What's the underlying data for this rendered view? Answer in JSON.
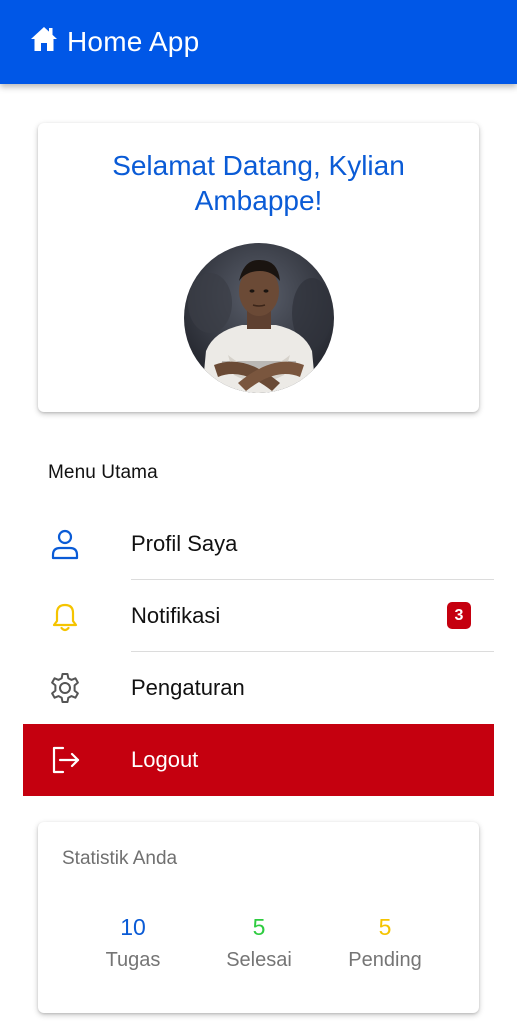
{
  "app": {
    "title": "Home App",
    "icon": "home-icon"
  },
  "welcome": {
    "greeting": "Selamat Datang, Kylian Ambappe!"
  },
  "menu": {
    "section_label": "Menu Utama",
    "items": [
      {
        "label": "Profil Saya",
        "icon": "user-icon",
        "icon_color": "#0a5bd6"
      },
      {
        "label": "Notifikasi",
        "icon": "bell-icon",
        "icon_color": "#f5c400",
        "badge": "3"
      },
      {
        "label": "Pengaturan",
        "icon": "gear-icon",
        "icon_color": "#555555"
      },
      {
        "label": "Logout",
        "icon": "logout-icon",
        "icon_color": "#ffffff"
      }
    ]
  },
  "stats": {
    "title": "Statistik Anda",
    "items": [
      {
        "value": "10",
        "label": "Tugas",
        "color": "#0a5bd6"
      },
      {
        "value": "5",
        "label": "Selesai",
        "color": "#2ecc40"
      },
      {
        "value": "5",
        "label": "Pending",
        "color": "#f5c400"
      }
    ]
  },
  "colors": {
    "primary": "#0057e7",
    "danger": "#c5000f"
  }
}
